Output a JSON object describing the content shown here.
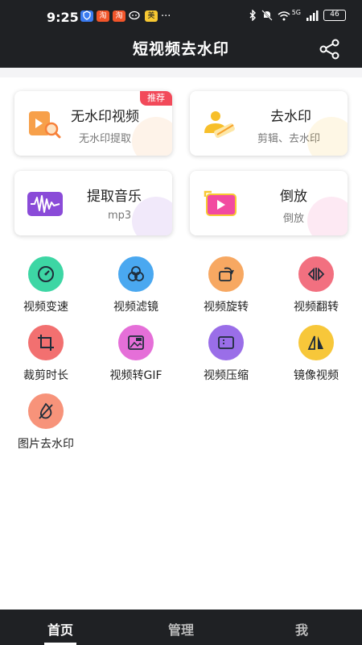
{
  "status": {
    "time": "9:25",
    "battery": "46",
    "icons_left": [
      "shield-icon",
      "taobao-icon",
      "taobao-icon",
      "wechat-icon",
      "meituan-icon"
    ],
    "icons_right": [
      "bluetooth-icon",
      "mute-icon",
      "wifi-icon",
      "signal-icon",
      "battery-icon"
    ],
    "left_labels": [
      "淘",
      "淘",
      "美"
    ],
    "more": "···",
    "net": "5G"
  },
  "header": {
    "title": "短视频去水印"
  },
  "cards": [
    {
      "title": "无水印视频",
      "sub": "无水印提取",
      "badge": "推荐",
      "color": "#f7a04a"
    },
    {
      "title": "去水印",
      "sub": "剪辑、去水印",
      "color": "#f7bf2a"
    },
    {
      "title": "提取音乐",
      "sub": "mp3",
      "color": "#8a4bd8"
    },
    {
      "title": "倒放",
      "sub": "倒放",
      "color": "#f24aa0"
    }
  ],
  "tools": [
    {
      "label": "视频变速",
      "color": "#3dd6a4",
      "icon": "speed-icon"
    },
    {
      "label": "视频滤镜",
      "color": "#4aa8f0",
      "icon": "filter-icon"
    },
    {
      "label": "视频旋转",
      "color": "#f7a862",
      "icon": "rotate-icon"
    },
    {
      "label": "视频翻转",
      "color": "#f27080",
      "icon": "flip-icon"
    },
    {
      "label": "裁剪时长",
      "color": "#f27070",
      "icon": "crop-icon"
    },
    {
      "label": "视频转GIF",
      "color": "#e56fd8",
      "icon": "gif-icon"
    },
    {
      "label": "视频压缩",
      "color": "#9a6ee8",
      "icon": "compress-icon"
    },
    {
      "label": "镜像视频",
      "color": "#f7c73a",
      "icon": "mirror-icon"
    },
    {
      "label": "图片去水印",
      "color": "#f7937a",
      "icon": "image-watermark-icon"
    }
  ],
  "nav": [
    {
      "label": "首页",
      "active": true
    },
    {
      "label": "管理",
      "active": false
    },
    {
      "label": "我",
      "active": false
    }
  ]
}
